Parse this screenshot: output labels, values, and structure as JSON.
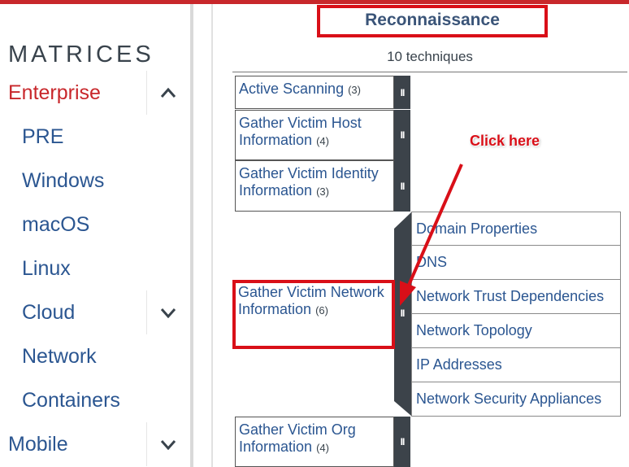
{
  "sidebar": {
    "title": "MATRICES",
    "items": [
      {
        "label": "Enterprise",
        "level": "top",
        "active": true,
        "toggle": "chevron-up"
      },
      {
        "label": "PRE",
        "level": "sub"
      },
      {
        "label": "Windows",
        "level": "sub"
      },
      {
        "label": "macOS",
        "level": "sub"
      },
      {
        "label": "Linux",
        "level": "sub"
      },
      {
        "label": "Cloud",
        "level": "sub",
        "toggle": "chevron-down"
      },
      {
        "label": "Network",
        "level": "sub"
      },
      {
        "label": "Containers",
        "level": "sub"
      },
      {
        "label": "Mobile",
        "level": "top",
        "toggle": "chevron-down"
      }
    ]
  },
  "tactic": {
    "title": "Reconnaissance",
    "count": "10 techniques"
  },
  "techniques": [
    {
      "name": "Active Scanning",
      "count": "(3)"
    },
    {
      "name": "Gather Victim Host Information",
      "count": "(4)"
    },
    {
      "name": "Gather Victim Identity Information",
      "count": "(3)"
    },
    {
      "name": "Gather Victim Network Information",
      "count": "(6)",
      "expanded": true
    },
    {
      "name": "Gather Victim Org Information",
      "count": "(4)"
    }
  ],
  "handle_glyph": "II",
  "subtechniques": [
    "Domain Properties",
    "DNS",
    "Network Trust Dependencies",
    "Network Topology",
    "IP Addresses",
    "Network Security Appliances"
  ],
  "annotation": {
    "text": "Click here",
    "color": "#d90f18"
  },
  "colors": {
    "accent_red": "#c8272b",
    "link_blue": "#2b5691",
    "handle_dark": "#3c434a",
    "highlight_red": "#d90f18"
  }
}
